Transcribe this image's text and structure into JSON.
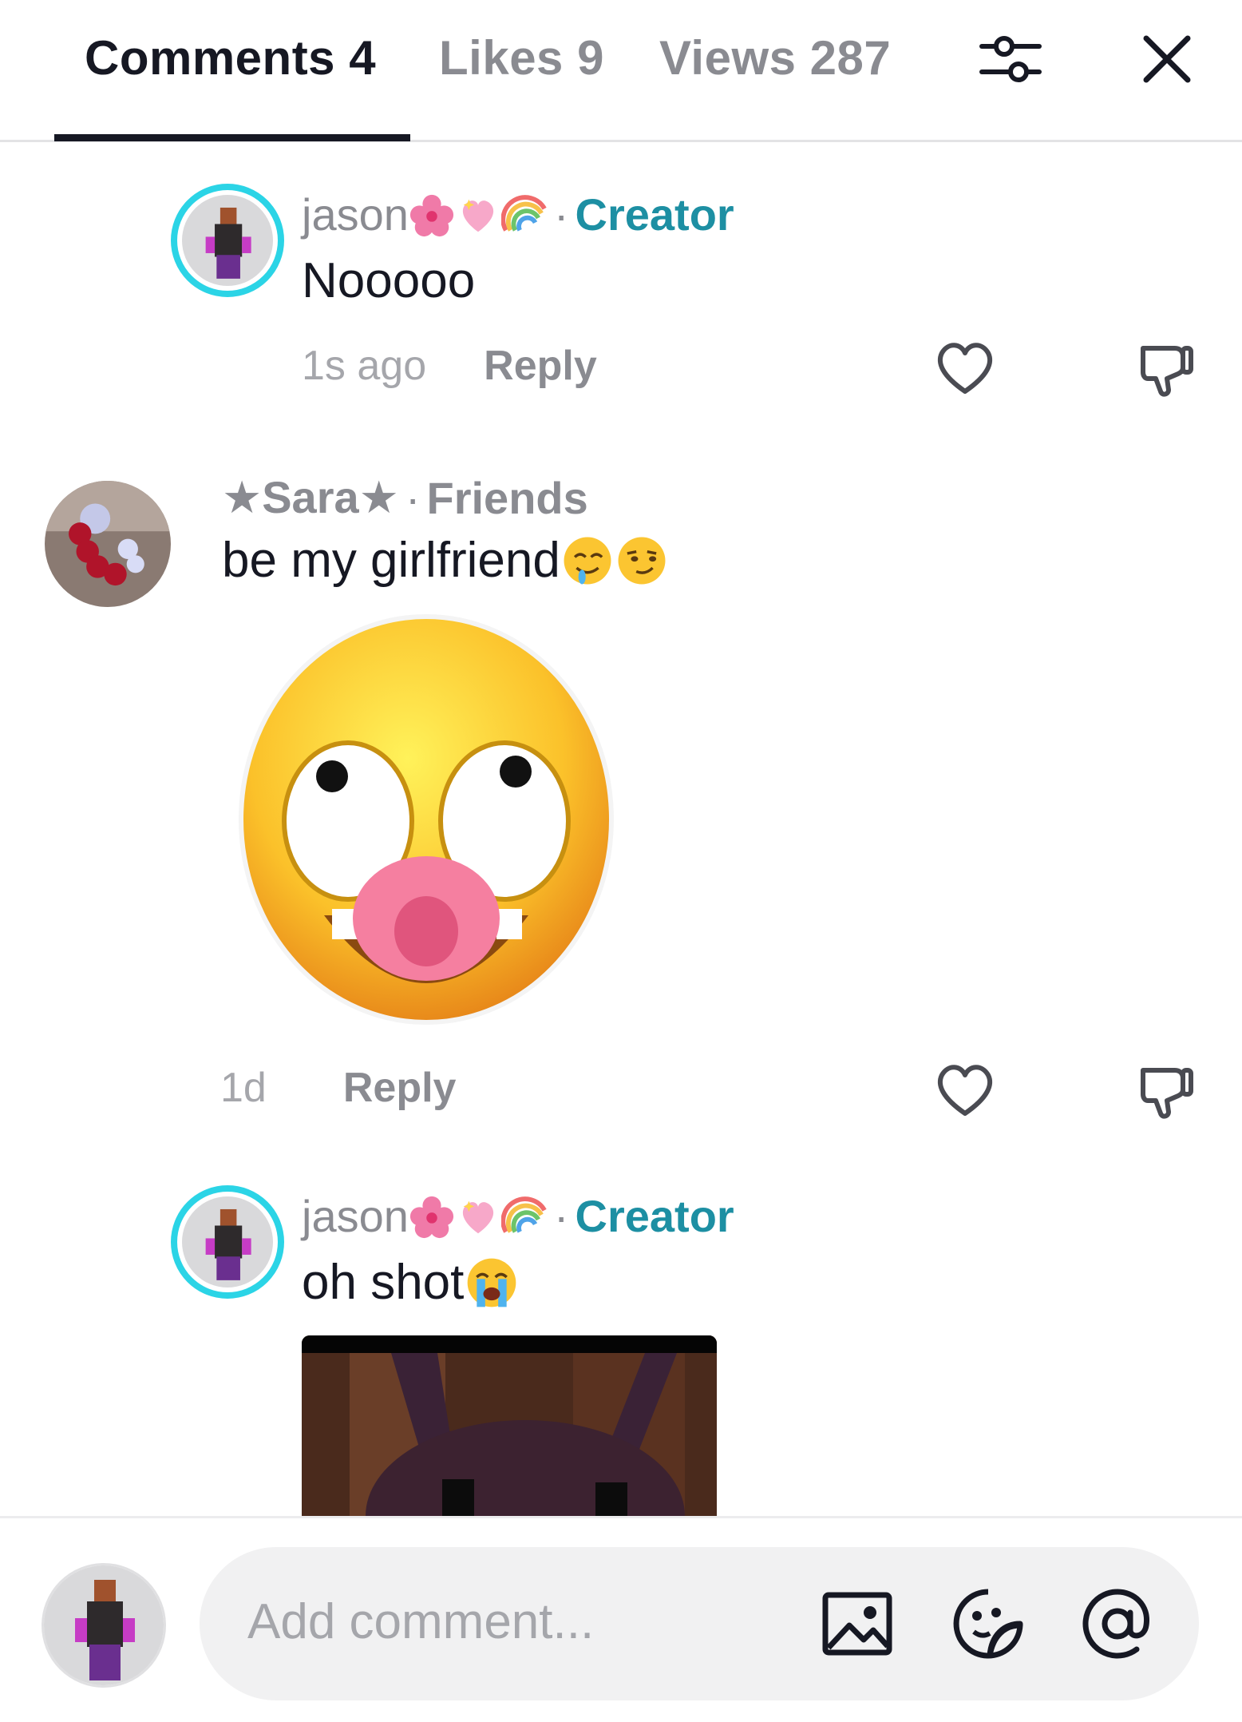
{
  "header": {
    "tabs": [
      {
        "label": "Comments 4",
        "active": true
      },
      {
        "label": "Likes 9",
        "active": false
      },
      {
        "label": "Views 287",
        "active": false
      }
    ],
    "filter_icon": "sliders-icon",
    "close_icon": "close-icon"
  },
  "comments": [
    {
      "username": "jason",
      "decorations": [
        "hibiscus-emoji",
        "sparkling-heart-emoji",
        "rainbow-emoji"
      ],
      "separator": "·",
      "badge": "Creator",
      "text": "Nooooo",
      "time": "1s ago",
      "reply_label": "Reply",
      "has_ring": true
    },
    {
      "username": "★Sara★",
      "separator": "·",
      "badge": "Friends",
      "text": "be my girlfriend",
      "text_emojis": [
        "drooling-face-emoji",
        "smirking-face-emoji"
      ],
      "sticker": "rolling-eyes-tongue-emoji-sticker",
      "time": "1d",
      "reply_label": "Reply",
      "has_ring": false
    },
    {
      "username": "jason",
      "decorations": [
        "hibiscus-emoji",
        "sparkling-heart-emoji",
        "rainbow-emoji"
      ],
      "separator": "·",
      "badge": "Creator",
      "text": "oh shot",
      "text_emojis": [
        "loudly-crying-face-emoji"
      ],
      "media": "video-thumbnail",
      "has_ring": true
    }
  ],
  "composer": {
    "placeholder": "Add comment...",
    "icons": [
      "image-icon",
      "sticker-icon",
      "mention-icon"
    ]
  },
  "colors": {
    "creator_badge": "#1d8fa3",
    "avatar_ring": "#2bd4e6",
    "text_primary": "#161823",
    "text_secondary": "#8a8b91"
  }
}
